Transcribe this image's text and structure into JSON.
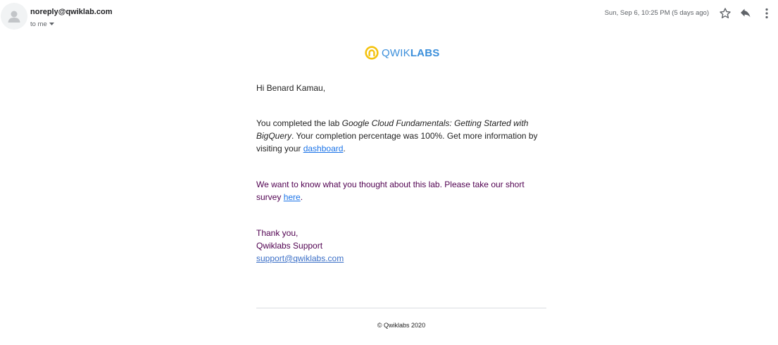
{
  "header": {
    "sender": "noreply@qwiklab.com",
    "recipient_label": "to me",
    "date": "Sun, Sep 6, 10:25 PM (5 days ago)",
    "icons": [
      "avatar",
      "star-icon",
      "reply-icon",
      "more-vert-icon",
      "chevron-down-icon"
    ]
  },
  "logo": {
    "text_light": "QWIK",
    "text_bold": "LABS",
    "brand_color": "#3b8fdb",
    "mark_color": "#f4c20d"
  },
  "body": {
    "greeting": "Hi Benard Kamau,",
    "completion": {
      "prefix": "You completed the lab ",
      "lab_name": "Google Cloud Fundamentals: Getting Started with BigQuery",
      "middle": ". Your completion percentage was 100%. Get more information by visiting your ",
      "link_text": "dashboard",
      "suffix": "."
    },
    "survey": {
      "prefix": "We want to know what you thought about this lab. Please take our short survey ",
      "link_text": "here",
      "suffix": "."
    },
    "signoff": {
      "thanks": "Thank you,",
      "team": "Qwiklabs Support",
      "email": "support@qwiklabs.com"
    }
  },
  "footer": {
    "copyright": "© Qwiklabs 2020"
  },
  "colors": {
    "link": "#1a73e8",
    "quoted_text": "#500050",
    "meta_text": "#5f6368"
  }
}
